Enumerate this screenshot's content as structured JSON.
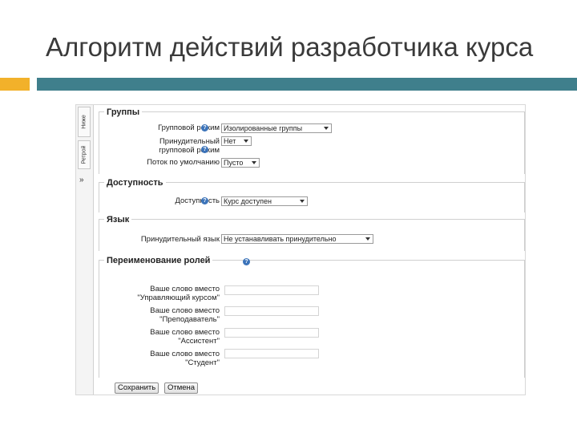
{
  "slide": {
    "title": "Алгоритм действий разработчика курса",
    "accent_color": "#f2b12a",
    "bar_color": "#3f7f8c"
  },
  "sidebar": {
    "tabs": [
      {
        "label": "Ниже"
      },
      {
        "label": "Ретрой"
      }
    ],
    "collapse_icon": "double-chevron-right-icon"
  },
  "groups": {
    "legend": "Группы",
    "group_mode": {
      "label": "Групповой режим",
      "value": "Изолированные группы"
    },
    "forced": {
      "label": "Принудительный групповой режим",
      "label_line1": "Принудительный",
      "label_line2": "групповой режим",
      "value": "Нет"
    },
    "default_grouping": {
      "label": "Поток по умолчанию",
      "value": "Пусто"
    }
  },
  "availability": {
    "legend": "Доступность",
    "field": {
      "label": "Доступность",
      "value": "Курс доступен"
    }
  },
  "language": {
    "legend": "Язык",
    "field": {
      "label": "Принудительный язык",
      "value": "Не устанавливать принудительно"
    }
  },
  "roles": {
    "legend": "Переименование ролей",
    "items": [
      {
        "line1": "Ваше слово вместо",
        "line2": "\"Управляющий курсом\"",
        "value": ""
      },
      {
        "line1": "Ваше слово вместо",
        "line2": "\"Преподаватель\"",
        "value": ""
      },
      {
        "line1": "Ваше слово вместо",
        "line2": "\"Ассистент\"",
        "value": ""
      },
      {
        "line1": "Ваше слово вместо",
        "line2": "\"Студент\"",
        "value": ""
      }
    ]
  },
  "buttons": {
    "save": "Сохранить",
    "cancel": "Отмена"
  },
  "help_glyph": "?"
}
